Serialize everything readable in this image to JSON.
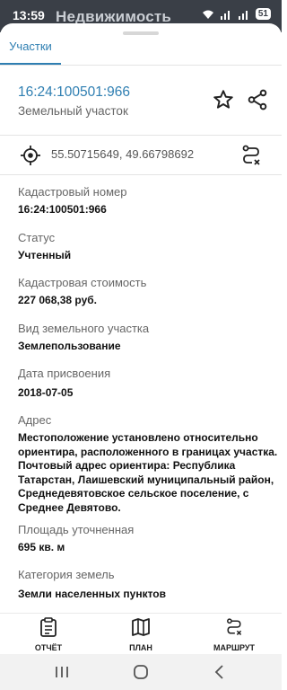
{
  "status_bar": {
    "time": "13:59",
    "app_name": "Недвижимость",
    "battery": "51"
  },
  "tab": {
    "label": "Участки"
  },
  "header": {
    "cadastral_number": "16:24:100501:966",
    "type": "Земельный участок"
  },
  "coords": "55.50715649, 49.66798692",
  "fields": [
    {
      "label": "Кадастровый номер",
      "value": "16:24:100501:966"
    },
    {
      "label": "Статус",
      "value": "Учтенный"
    },
    {
      "label": "Кадастровая стоимость",
      "value": "227 068,38 руб."
    },
    {
      "label": "Вид земельного участка",
      "value": "Землепользование"
    },
    {
      "label": "Дата присвоения",
      "value": "2018-07-05"
    },
    {
      "label": "Адрес",
      "value": "Местоположение установлено относительно ориентира, расположенного в границах участка. Почтовый адрес ориентира: Республика Татарстан, Лаишевский муниципальный район, Среднедевятовское сельское поселение, с Среднее Девятово."
    },
    {
      "label": "Площадь уточненная",
      "value": "695 кв. м"
    },
    {
      "label": "Категория земель",
      "value": "Земли населенных пунктов"
    }
  ],
  "bottom_nav": [
    {
      "label": "ОТЧЁТ",
      "icon": "report-icon"
    },
    {
      "label": "ПЛАН",
      "icon": "map-icon"
    },
    {
      "label": "МАРШРУТ",
      "icon": "route-icon"
    }
  ],
  "colors": {
    "accent": "#2f7fb2",
    "status_bar": "#3a3f47"
  }
}
